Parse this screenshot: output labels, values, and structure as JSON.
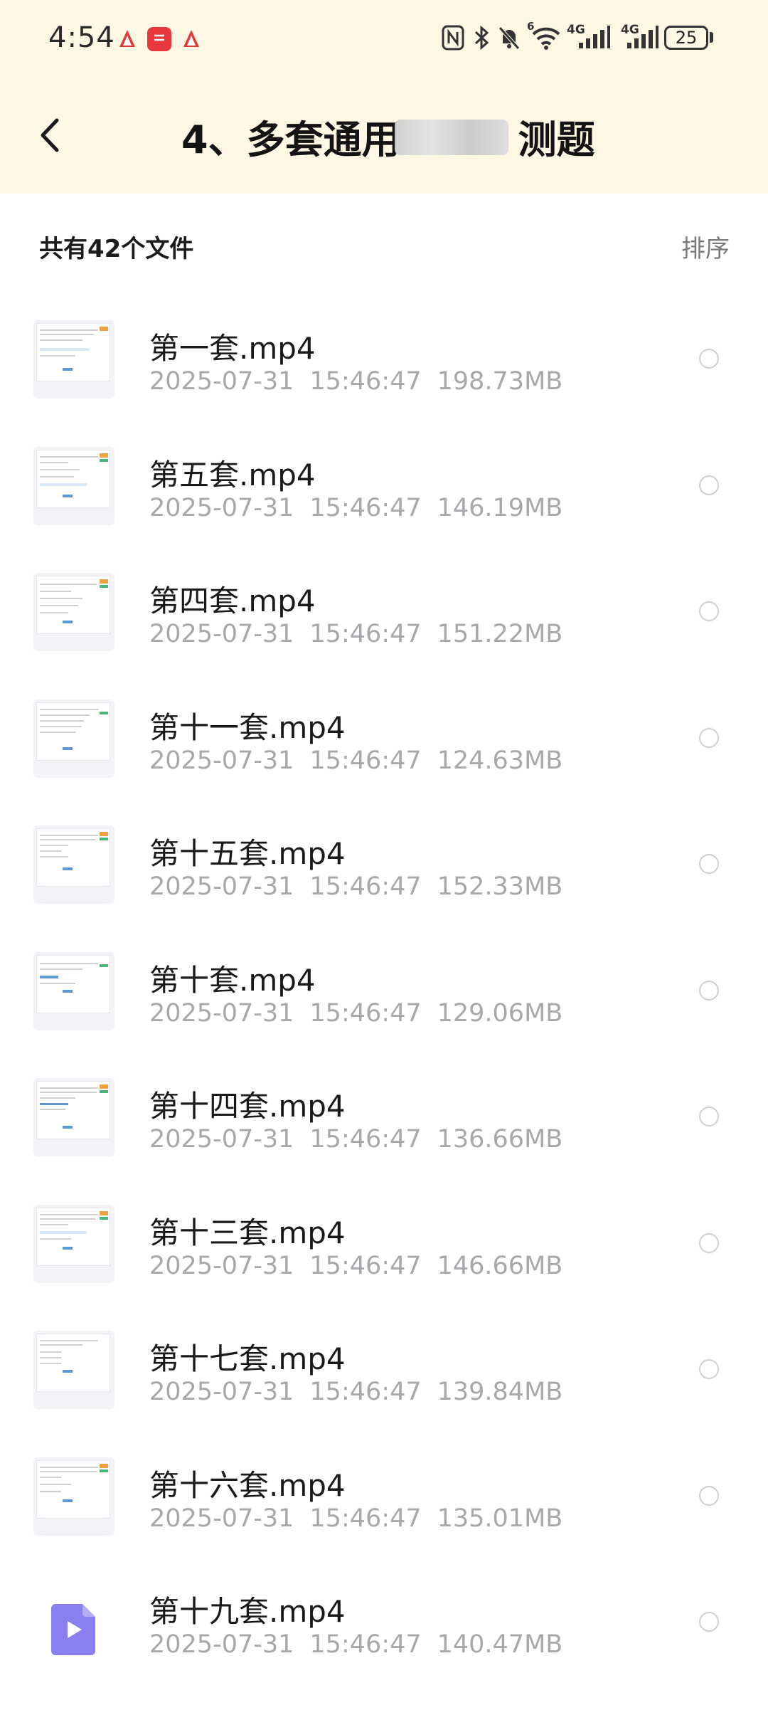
{
  "status_bar": {
    "time": "4:54",
    "notification_icons": [
      "huawei-flower-icon",
      "huawei-app-icon",
      "huawei-flower-icon"
    ],
    "signal_label_1": "4G",
    "signal_label_2": "4G",
    "wifi_badge": "6",
    "battery": "25"
  },
  "nav": {
    "title": "4、多套通用",
    "title_suffix": "测题"
  },
  "summary": {
    "count_text": "共有42个文件",
    "sort_label": "排序"
  },
  "files": [
    {
      "name": "第一套.mp4",
      "date": "2025-07-31",
      "time": "15:46:47",
      "size": "198.73MB"
    },
    {
      "name": "第五套.mp4",
      "date": "2025-07-31",
      "time": "15:46:47",
      "size": "146.19MB"
    },
    {
      "name": "第四套.mp4",
      "date": "2025-07-31",
      "time": "15:46:47",
      "size": "151.22MB"
    },
    {
      "name": "第十一套.mp4",
      "date": "2025-07-31",
      "time": "15:46:47",
      "size": "124.63MB"
    },
    {
      "name": "第十五套.mp4",
      "date": "2025-07-31",
      "time": "15:46:47",
      "size": "152.33MB"
    },
    {
      "name": "第十套.mp4",
      "date": "2025-07-31",
      "time": "15:46:47",
      "size": "129.06MB"
    },
    {
      "name": "第十四套.mp4",
      "date": "2025-07-31",
      "time": "15:46:47",
      "size": "136.66MB"
    },
    {
      "name": "第十三套.mp4",
      "date": "2025-07-31",
      "time": "15:46:47",
      "size": "146.66MB"
    },
    {
      "name": "第十七套.mp4",
      "date": "2025-07-31",
      "time": "15:46:47",
      "size": "139.84MB"
    },
    {
      "name": "第十六套.mp4",
      "date": "2025-07-31",
      "time": "15:46:47",
      "size": "135.01MB"
    },
    {
      "name": "第十九套.mp4",
      "date": "2025-07-31",
      "time": "15:46:47",
      "size": "140.47MB"
    }
  ],
  "colors": {
    "header_bg": "#fdf7e3",
    "video_icon": "#8a7ff0",
    "meta_text": "#a8a8ac"
  }
}
